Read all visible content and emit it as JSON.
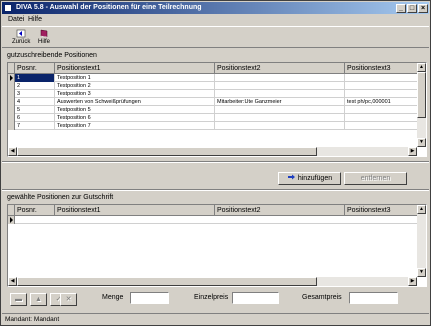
{
  "window": {
    "title": "DIVA 5.8 - Auswahl der Positionen für eine Teilrechnung"
  },
  "menu": [
    "Datei",
    "Hilfe"
  ],
  "toolbar": {
    "back_label": "Zurück",
    "help_label": "Hilfe"
  },
  "top_grid": {
    "group_label": "gutzuschreibende Positionen",
    "headers": [
      "Posnr.",
      "Positionstext1",
      "Positionstext2",
      "Positionstext3"
    ],
    "rows": [
      [
        "1",
        "Testposition 1",
        "",
        ""
      ],
      [
        "2",
        "Testposition 2",
        "",
        ""
      ],
      [
        "3",
        "Testposition 3",
        "",
        ""
      ],
      [
        "4",
        "Auswerten von Schweißprüfungen",
        "Mitarbeiter:Ute Ganzmeier",
        "test ph/pc,000001"
      ],
      [
        "5",
        "Testposition 5",
        "",
        ""
      ],
      [
        "6",
        "Testposition 6",
        "",
        ""
      ],
      [
        "7",
        "Testposition 7",
        "",
        ""
      ]
    ]
  },
  "buttons": {
    "add_label": "hinzufügen",
    "remove_label": "entfernen"
  },
  "bottom_grid": {
    "group_label": "gewählte Positionen zur Gutschrift",
    "headers": [
      "Posnr.",
      "Positionstext1",
      "Positionstext2",
      "Positionstext3"
    ]
  },
  "fields": {
    "menge_label": "Menge",
    "einzelpreis_label": "Einzelpreis",
    "gesamtpreis_label": "Gesamtpreis"
  },
  "status": {
    "text": "Mandant: Mandant"
  },
  "colors": {
    "title_start": "#0a246a",
    "title_end": "#a6caf0",
    "face": "#d4d0c8"
  }
}
